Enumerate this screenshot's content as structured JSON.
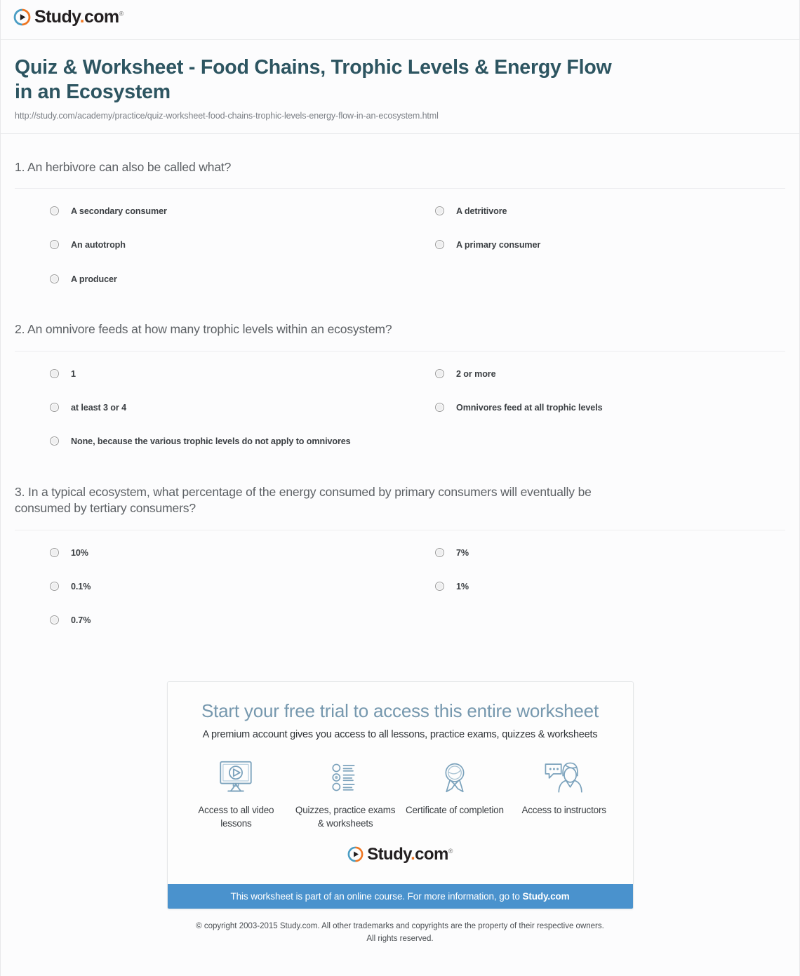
{
  "header": {
    "logo_name": "Study",
    "logo_dot": ".",
    "logo_domain": "com",
    "logo_tm": "®"
  },
  "document": {
    "title": "Quiz & Worksheet - Food Chains, Trophic Levels & Energy Flow in an Ecosystem",
    "url": "http://study.com/academy/practice/quiz-worksheet-food-chains-trophic-levels-energy-flow-in-an-ecosystem.html"
  },
  "questions": [
    {
      "text": "1. An herbivore can also be called what?",
      "answers": [
        "A secondary consumer",
        "A detritivore",
        "An autotroph",
        "A primary consumer",
        "A producer"
      ]
    },
    {
      "text": "2. An omnivore feeds at how many trophic levels within an ecosystem?",
      "answers": [
        "1",
        "2 or more",
        "at least 3 or 4",
        "Omnivores feed at all trophic levels",
        "None, because the various trophic levels do not apply to omnivores"
      ]
    },
    {
      "text": "3. In a typical ecosystem, what percentage of the energy consumed by primary consumers will eventually be consumed by tertiary consumers?",
      "answers": [
        "10%",
        "7%",
        "0.1%",
        "1%",
        "0.7%"
      ]
    }
  ],
  "promo": {
    "title": "Start your free trial to access this entire worksheet",
    "subtitle": "A premium account gives you access to all lessons, practice exams, quizzes & worksheets",
    "features": [
      {
        "icon": "monitor-play-icon",
        "label": "Access to all video lessons"
      },
      {
        "icon": "quiz-list-icon",
        "label": "Quizzes, practice exams & worksheets"
      },
      {
        "icon": "award-ribbon-icon",
        "label": "Certificate of completion"
      },
      {
        "icon": "instructor-chat-icon",
        "label": "Access to instructors"
      }
    ],
    "bar_text": "This worksheet is part of an online course. For more information, go to ",
    "bar_link": "Study.com"
  },
  "footer": {
    "copyright_line1": "© copyright 2003-2015 Study.com. All other trademarks and copyrights are the property of their respective owners.",
    "copyright_line2": "All rights reserved."
  },
  "colors": {
    "title": "#2d5561",
    "promo_title": "#7698ae",
    "promo_bar": "#4a92cd",
    "logo_orange": "#ef7622",
    "logo_blue": "#4a9dc4",
    "icon_blue": "#6f95ad"
  }
}
